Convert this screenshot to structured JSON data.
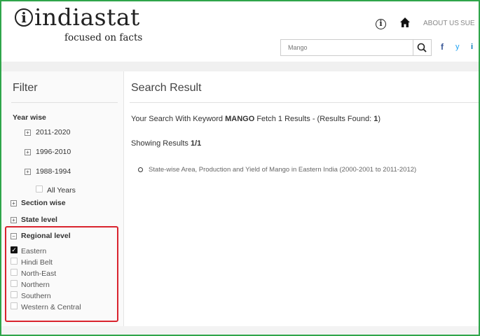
{
  "header": {
    "logo_mark": "i",
    "logo_text": "indiastat",
    "tagline": "focused on facts",
    "nav_info_glyph": "i",
    "nav_about": "ABOUT US",
    "nav_sub": "SUE",
    "search_placeholder": "Mango",
    "social": {
      "facebook": "f",
      "twitter": "y",
      "linkedin": "i"
    }
  },
  "filter": {
    "title": "Filter",
    "year_wise": {
      "label": "Year wise",
      "items": [
        {
          "label": "2011-2020",
          "toggle": "+"
        },
        {
          "label": "1996-2010",
          "toggle": "+"
        },
        {
          "label": "1988-1994",
          "toggle": "+"
        }
      ],
      "all_years": "All Years"
    },
    "section_wise": {
      "label": "Section wise",
      "toggle": "+"
    },
    "state_level": {
      "label": "State level",
      "toggle": "+"
    },
    "regional_level": {
      "label": "Regional level",
      "toggle": "−",
      "options": [
        {
          "label": "Eastern",
          "checked": true,
          "mark": "✓"
        },
        {
          "label": "Hindi Belt",
          "checked": false
        },
        {
          "label": "North-East",
          "checked": false
        },
        {
          "label": "Northern",
          "checked": false
        },
        {
          "label": "Southern",
          "checked": false
        },
        {
          "label": "Western & Central",
          "checked": false
        }
      ]
    }
  },
  "results": {
    "title": "Search Result",
    "query_prefix": "Your Search With Keyword ",
    "keyword": "MANGO",
    "query_middle": " Fetch 1 Results - (Results Found: ",
    "found_count": "1",
    "query_suffix": ")",
    "showing_prefix": "Showing Results ",
    "showing_value": "1/1",
    "items": [
      "State-wise Area, Production and Yield of Mango in Eastern India (2000-2001 to 2011-2012)"
    ]
  },
  "colors": {
    "frame": "#2fa54a",
    "highlight": "#d9232e",
    "facebook": "#3b5998",
    "twitter": "#1da1f2",
    "linkedin": "#0077b5"
  }
}
